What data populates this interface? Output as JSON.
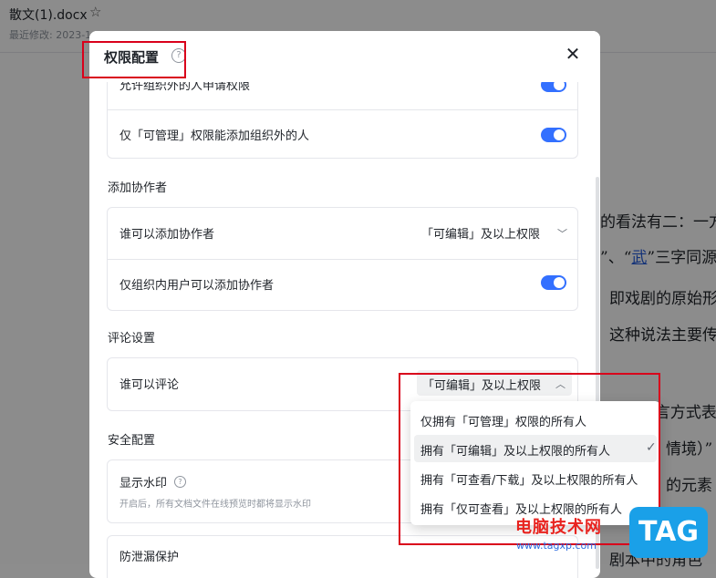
{
  "document": {
    "title": "散文(1).docx",
    "meta": "最近修改: 2023-1…",
    "text_lines": [
      "的看法有二：一方",
      "”、“",
      "武",
      "”三字同源",
      "即戏剧的原始形",
      "这种说法主要传",
      "是以”代言方式表",
      "情境）”",
      "的元素",
      "剧本中的角色"
    ]
  },
  "modal": {
    "title": "权限配置",
    "help_icon": "question-circle-icon",
    "close_icon": "close-icon",
    "top_card": {
      "row1_label": "允许组织外的人申请权限",
      "row2_label": "仅「可管理」权限能添加组织外的人"
    },
    "sections": {
      "add_collaborators": {
        "title": "添加协作者",
        "who_can_add_label": "谁可以添加协作者",
        "who_can_add_value": "「可编辑」及以上权限",
        "internal_only_label": "仅组织内用户可以添加协作者"
      },
      "comments": {
        "title": "评论设置",
        "who_can_comment_label": "谁可以评论",
        "who_can_comment_value": "「可编辑」及以上权限"
      },
      "security": {
        "title": "安全配置",
        "watermark_label": "显示水印",
        "watermark_desc": "开启后，所有文档文件在线预览时都将显示水印",
        "leak_protection_label": "防泄漏保护"
      }
    }
  },
  "dropdown": {
    "options": [
      {
        "label": "仅拥有「可管理」权限的所有人",
        "selected": false
      },
      {
        "label": "拥有「可编辑」及以上权限的所有人",
        "selected": true
      },
      {
        "label": "拥有「可查看/下载」及以上权限的所有人",
        "selected": false
      },
      {
        "label": "拥有「仅可查看」及以上权限的所有人",
        "selected": false
      }
    ]
  },
  "watermark": {
    "text": "电脑技术网",
    "url": "www.tagxp.com",
    "logo": "TAG"
  },
  "colors": {
    "accent": "#3370ff",
    "annotation": "#d9001b",
    "overlay": "rgba(0,0,0,0.45)"
  }
}
